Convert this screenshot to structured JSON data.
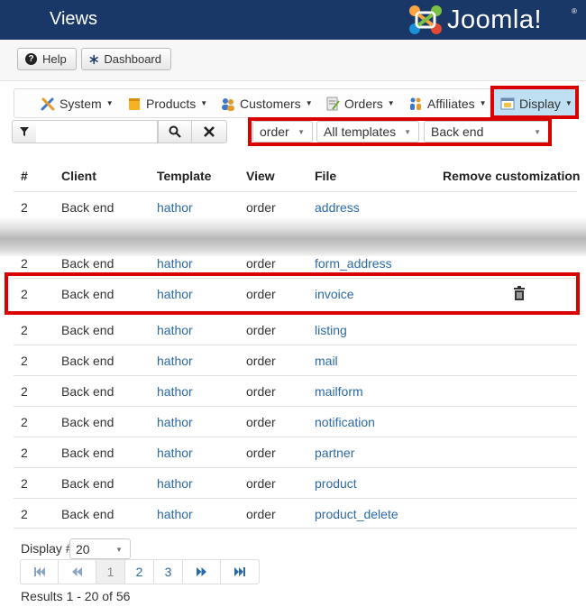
{
  "header": {
    "title": "Views",
    "logo_text": "Joomla!"
  },
  "toolbar": {
    "help_label": "Help",
    "dashboard_label": "Dashboard"
  },
  "menu": {
    "items": [
      {
        "label": "System",
        "icon": "tools-icon"
      },
      {
        "label": "Products",
        "icon": "box-icon"
      },
      {
        "label": "Customers",
        "icon": "users-icon"
      },
      {
        "label": "Orders",
        "icon": "orders-icon"
      },
      {
        "label": "Affiliates",
        "icon": "affiliates-icon"
      },
      {
        "label": "Display",
        "icon": "display-icon",
        "active": true
      }
    ]
  },
  "filters": {
    "search_value": "",
    "view_select": "order",
    "template_select": "All templates",
    "client_select": "Back end"
  },
  "table": {
    "headers": [
      "#",
      "Client",
      "Template",
      "View",
      "File",
      "Remove customization"
    ],
    "rows": [
      {
        "num": "2",
        "client": "Back end",
        "template": "hathor",
        "view": "order",
        "file": "address"
      },
      {
        "num": "2",
        "client": "Back end",
        "template": "hathor",
        "view": "order",
        "file": "form_address"
      },
      {
        "num": "2",
        "client": "Back end",
        "template": "hathor",
        "view": "order",
        "file": "invoice",
        "removable": true
      },
      {
        "num": "2",
        "client": "Back end",
        "template": "hathor",
        "view": "order",
        "file": "listing"
      },
      {
        "num": "2",
        "client": "Back end",
        "template": "hathor",
        "view": "order",
        "file": "mail"
      },
      {
        "num": "2",
        "client": "Back end",
        "template": "hathor",
        "view": "order",
        "file": "mailform"
      },
      {
        "num": "2",
        "client": "Back end",
        "template": "hathor",
        "view": "order",
        "file": "notification"
      },
      {
        "num": "2",
        "client": "Back end",
        "template": "hathor",
        "view": "order",
        "file": "partner"
      },
      {
        "num": "2",
        "client": "Back end",
        "template": "hathor",
        "view": "order",
        "file": "product"
      },
      {
        "num": "2",
        "client": "Back end",
        "template": "hathor",
        "view": "order",
        "file": "product_delete"
      }
    ]
  },
  "footer": {
    "display_label": "Display #",
    "display_value": "20",
    "pages": [
      "1",
      "2",
      "3"
    ],
    "current_page": "1",
    "results_text": "Results 1 - 20 of 56"
  },
  "colors": {
    "header_bg": "#1a3867",
    "link": "#2a6aa8",
    "highlight": "#d90000",
    "active_menu": "#bfe0f3"
  }
}
